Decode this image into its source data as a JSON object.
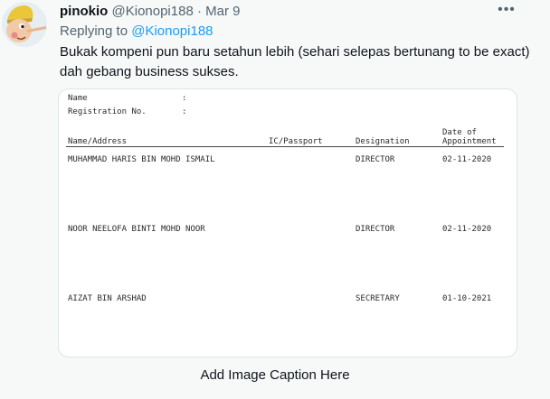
{
  "tweet": {
    "author_name": "pinokio",
    "handle": "@Kionopi188",
    "separator": "·",
    "date": "Mar 9",
    "more_label": "•••",
    "replying_prefix": "Replying to ",
    "replying_to": "@Kionopi188",
    "text": "Bukak kompeni pun baru setahun lebih (sehari selepas bertunang to be exact) dah gebang business sukses."
  },
  "document": {
    "name_label": "Name",
    "reg_label": "Registration No.",
    "colon": ":",
    "headers": {
      "name": "Name/Address",
      "ic": "IC/Passport",
      "designation": "Designation",
      "date_line1": "Date of",
      "date_line2": "Appointment"
    },
    "rows": [
      {
        "name": "MUHAMMAD HARIS BIN MOHD ISMAIL",
        "designation": "DIRECTOR",
        "date": "02-11-2020"
      },
      {
        "name": "NOOR NEELOFA BINTI MOHD NOOR",
        "designation": "DIRECTOR",
        "date": "02-11-2020"
      },
      {
        "name": "AIZAT BIN ARSHAD",
        "designation": "SECRETARY",
        "date": "01-10-2021"
      }
    ]
  },
  "caption": "Add Image Caption Here",
  "colors": {
    "link": "#1d9bf0",
    "secondary_text": "#536471",
    "background": "#f7f9f9"
  }
}
